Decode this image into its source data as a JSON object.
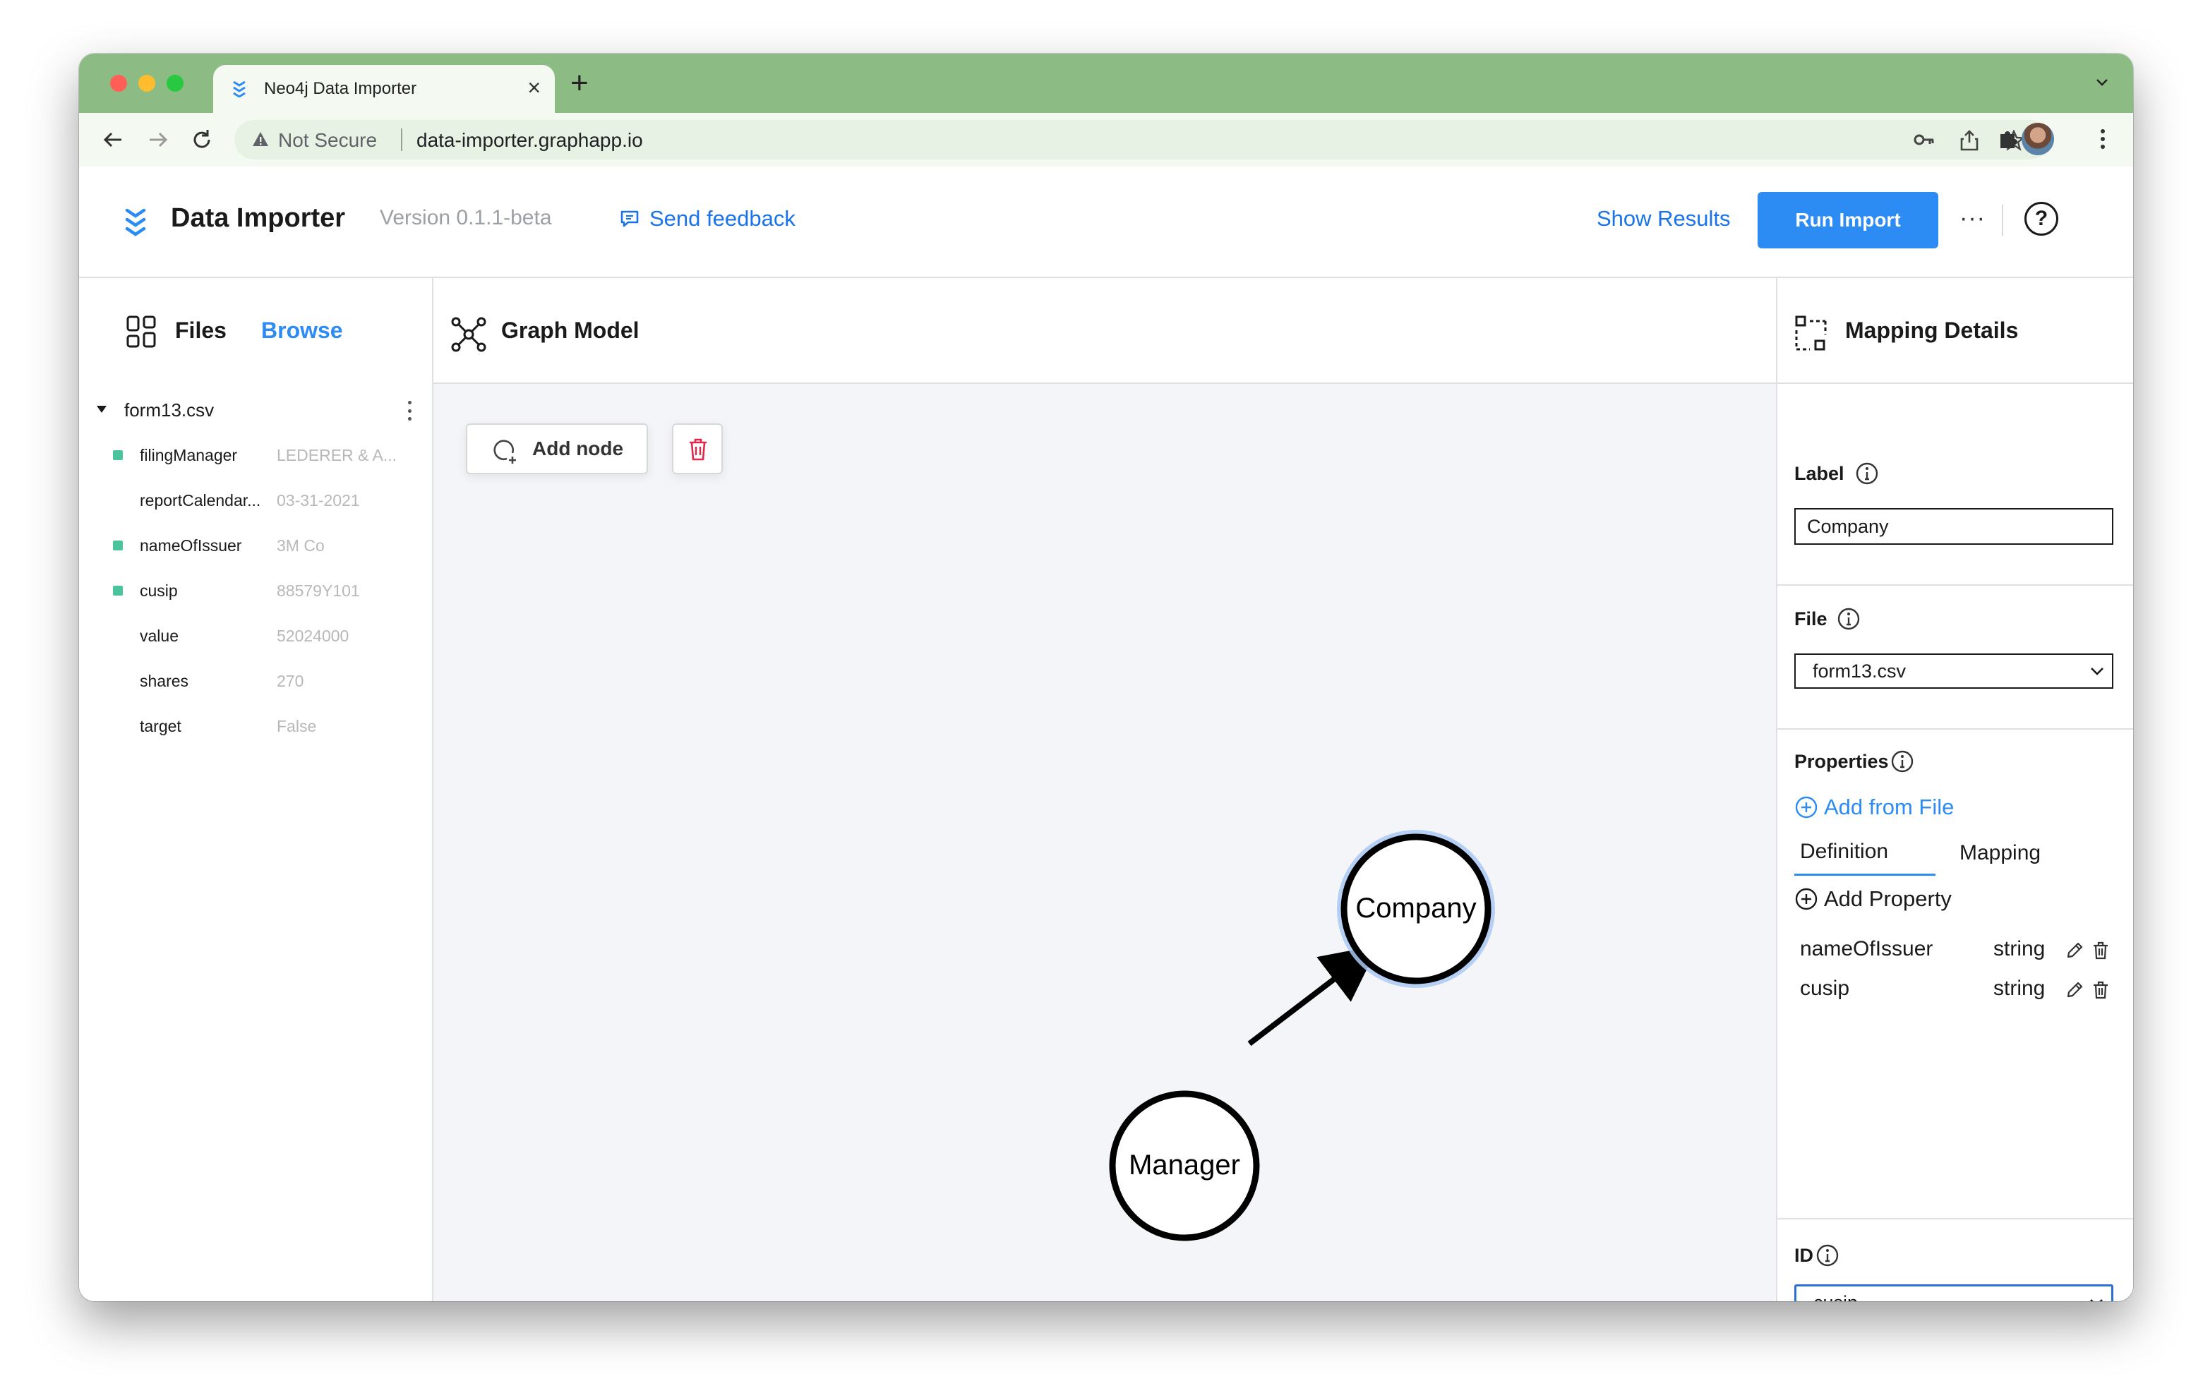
{
  "browser": {
    "tab_title": "Neo4j Data Importer",
    "not_secure": "Not Secure",
    "url": "data-importer.graphapp.io"
  },
  "header": {
    "title": "Data Importer",
    "version": "Version 0.1.1-beta",
    "feedback": "Send feedback",
    "show_results": "Show Results",
    "run_import": "Run Import",
    "more": "···",
    "help": "?"
  },
  "files": {
    "title": "Files",
    "browse": "Browse",
    "file_name": "form13.csv",
    "columns": [
      {
        "name": "filingManager",
        "value": "LEDERER & A...",
        "mapped": true
      },
      {
        "name": "reportCalendar...",
        "value": "03-31-2021",
        "mapped": false
      },
      {
        "name": "nameOfIssuer",
        "value": "3M Co",
        "mapped": true
      },
      {
        "name": "cusip",
        "value": "88579Y101",
        "mapped": true
      },
      {
        "name": "value",
        "value": "52024000",
        "mapped": false
      },
      {
        "name": "shares",
        "value": "270",
        "mapped": false
      },
      {
        "name": "target",
        "value": "False",
        "mapped": false
      }
    ],
    "mapped_color": "#4cc49b"
  },
  "graph": {
    "title": "Graph Model",
    "add_node": "Add node",
    "nodes": [
      {
        "id": "company",
        "label": "Company",
        "selected": true
      },
      {
        "id": "manager",
        "label": "Manager",
        "selected": false
      }
    ],
    "edges": [
      {
        "from": "manager",
        "to": "company"
      }
    ]
  },
  "mapping": {
    "title": "Mapping Details",
    "label_heading": "Label",
    "label_value": "Company",
    "file_heading": "File",
    "file_value": "form13.csv",
    "properties_heading": "Properties",
    "add_from_file": "Add from File",
    "tab_definition": "Definition",
    "tab_mapping": "Mapping",
    "add_property": "Add Property",
    "properties": [
      {
        "name": "nameOfIssuer",
        "type": "string"
      },
      {
        "name": "cusip",
        "type": "string"
      }
    ],
    "id_heading": "ID",
    "id_value": "cusip"
  },
  "colors": {
    "accent": "#2c8cf3",
    "tab_strip": "#8cbb83",
    "selected_ring": "#a9c8f5",
    "delete": "#e0284a"
  }
}
